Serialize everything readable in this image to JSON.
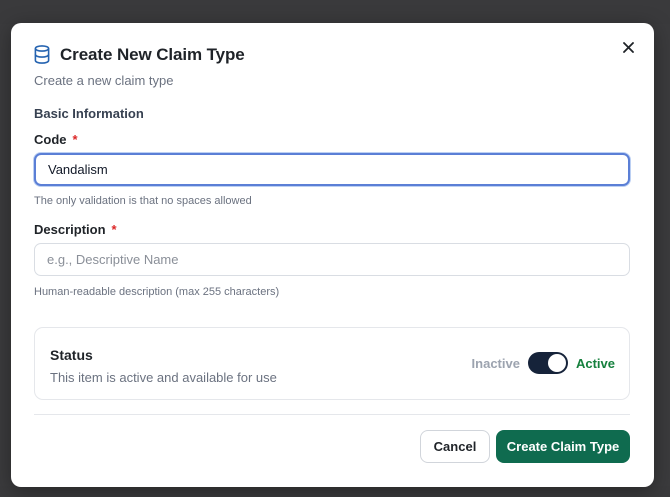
{
  "dialog": {
    "title": "Create New Claim Type",
    "subtitle": "Create a new claim type",
    "title_icon": "database-icon",
    "close_icon": "close-icon"
  },
  "basic_info": {
    "section_label": "Basic Information",
    "code": {
      "label": "Code",
      "required_marker": "*",
      "value": "Vandalism",
      "help": "The only validation is that no spaces allowed"
    },
    "description": {
      "label": "Description",
      "required_marker": "*",
      "value": "",
      "placeholder": "e.g., Descriptive Name",
      "help": "Human-readable description (max 255 characters)"
    }
  },
  "status": {
    "title": "Status",
    "description": "This item is active and available for use",
    "inactive_label": "Inactive",
    "active_label": "Active",
    "is_active": true
  },
  "actions": {
    "cancel_label": "Cancel",
    "create_label": "Create Claim Type"
  },
  "colors": {
    "primary": "#0f6b4f",
    "active_text": "#15803d",
    "toggle_on": "#16233a",
    "required": "#dc2626",
    "focus_ring": "#5b7fd6"
  }
}
